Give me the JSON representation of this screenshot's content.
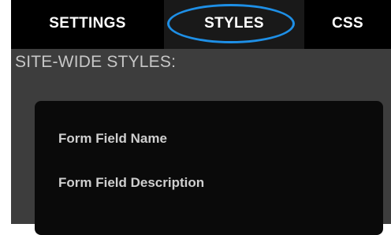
{
  "tabs": [
    {
      "label": "SETTINGS",
      "active": false
    },
    {
      "label": "STYLES",
      "active": true
    },
    {
      "label": "CSS",
      "active": false
    }
  ],
  "section": {
    "title": "SITE-WIDE STYLES:"
  },
  "preview": {
    "field_name": "Form Field Name",
    "field_description": "Form Field Description"
  },
  "colors": {
    "accent": "#1e8fe6",
    "panel_bg": "#3d3d3d",
    "tab_bg": "#000000",
    "preview_bg": "#0a0a0a"
  }
}
